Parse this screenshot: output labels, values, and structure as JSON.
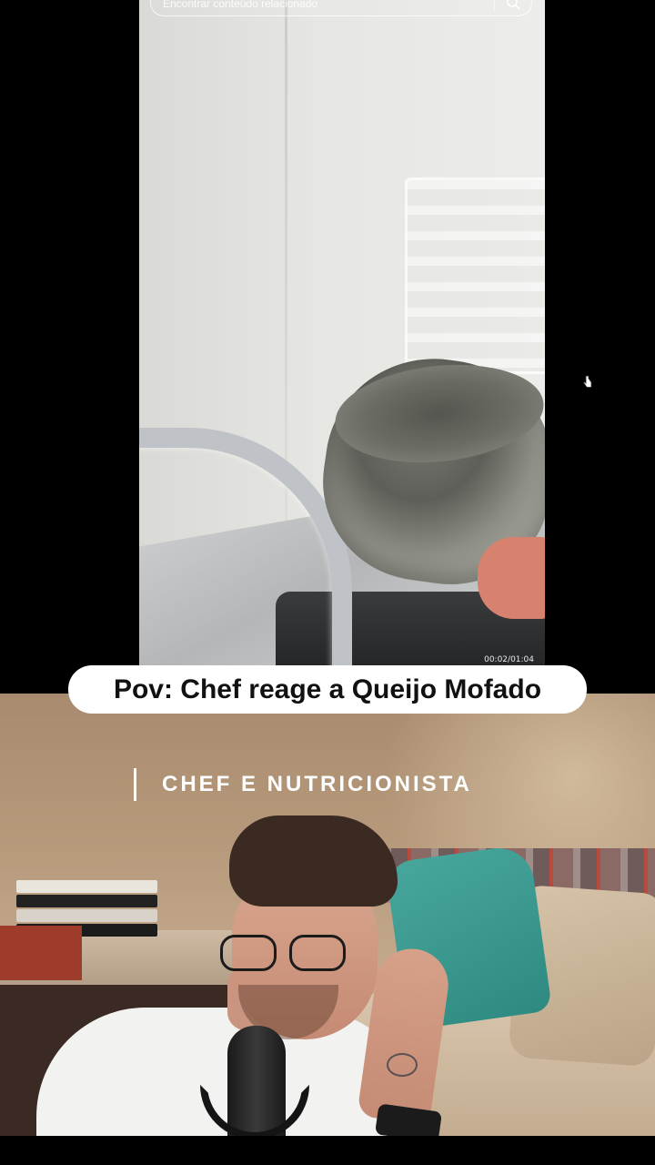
{
  "search": {
    "placeholder": "Encontrar conteúdo relacionado"
  },
  "video": {
    "timestamp": "00:02/01:04"
  },
  "caption": {
    "text": "Pov: Chef reage a Queijo Mofado"
  },
  "reaction": {
    "lower_third": "CHEF E NUTRICIONISTA"
  },
  "icons": {
    "search": "search-icon",
    "cursor": "hand-cursor-icon"
  },
  "colors": {
    "background": "#000000",
    "caption_bg": "#ffffff",
    "caption_text": "#111111",
    "lower_third_text": "#ffffff"
  }
}
